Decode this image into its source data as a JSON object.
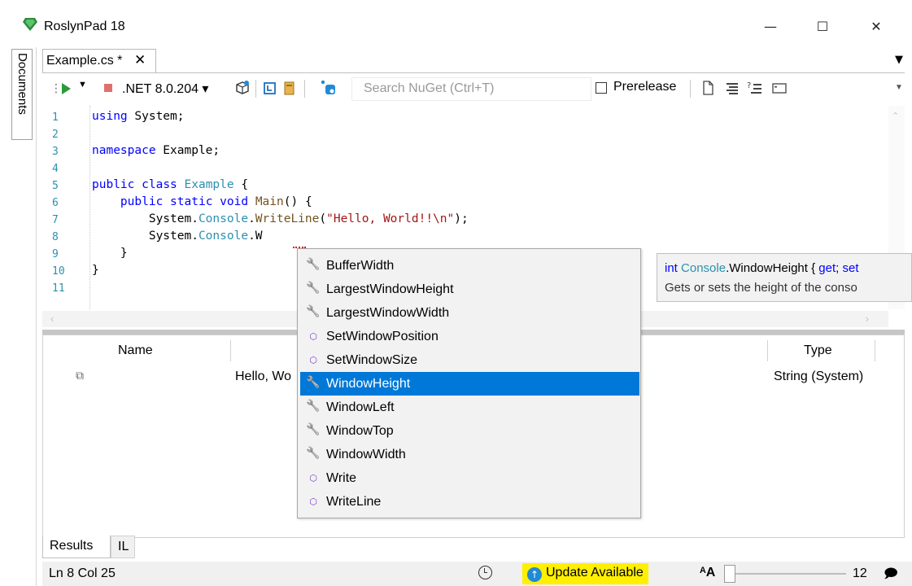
{
  "window": {
    "title": "RoslynPad 18",
    "minimize": "—",
    "maximize": "☐",
    "close": "✕"
  },
  "side_tab": {
    "label": "Documents"
  },
  "document_tab": {
    "label": "Example.cs *",
    "close": "✕",
    "menu": "▬"
  },
  "toolbar": {
    "platform": ".NET 8.0.204 ▾",
    "search_placeholder": "Search NuGet (Ctrl+T)",
    "prerelease": "Prerelease"
  },
  "editor": {
    "line_numbers": [
      "1",
      "2",
      "3",
      "4",
      "5",
      "6",
      "7",
      "8",
      "9",
      "10",
      "11"
    ]
  },
  "results": {
    "columns": {
      "name": "Name",
      "type": "Type"
    },
    "row": {
      "value": "Hello, Wo",
      "type": "String (System)"
    }
  },
  "bottom_tabs": [
    "Results",
    "IL"
  ],
  "status": {
    "position": "Ln 8 Col 25",
    "update": "Update Available",
    "font_icon": "ᴬA",
    "zoom": "12"
  },
  "completion": {
    "selected_index": 5,
    "items": [
      {
        "label": "BufferWidth",
        "kind": "property"
      },
      {
        "label": "LargestWindowHeight",
        "kind": "property"
      },
      {
        "label": "LargestWindowWidth",
        "kind": "property"
      },
      {
        "label": "SetWindowPosition",
        "kind": "method"
      },
      {
        "label": "SetWindowSize",
        "kind": "method"
      },
      {
        "label": "WindowHeight",
        "kind": "property"
      },
      {
        "label": "WindowLeft",
        "kind": "property"
      },
      {
        "label": "WindowTop",
        "kind": "property"
      },
      {
        "label": "WindowWidth",
        "kind": "property"
      },
      {
        "label": "Write",
        "kind": "method"
      },
      {
        "label": "WriteLine",
        "kind": "method"
      }
    ]
  },
  "tooltip": {
    "sig_type": "int",
    "sig_class": "Console",
    "sig_member": ".WindowHeight { ",
    "sig_get": "get",
    "sig_sep": "; ",
    "sig_set": "set",
    "doc": "Gets or sets the height of the conso"
  },
  "colors": {
    "keyword": "#0000ff",
    "type": "#2b91af",
    "method": "#74531f",
    "string": "#a31515",
    "selection": "#0078d7",
    "update_bg": "#ffef00"
  }
}
